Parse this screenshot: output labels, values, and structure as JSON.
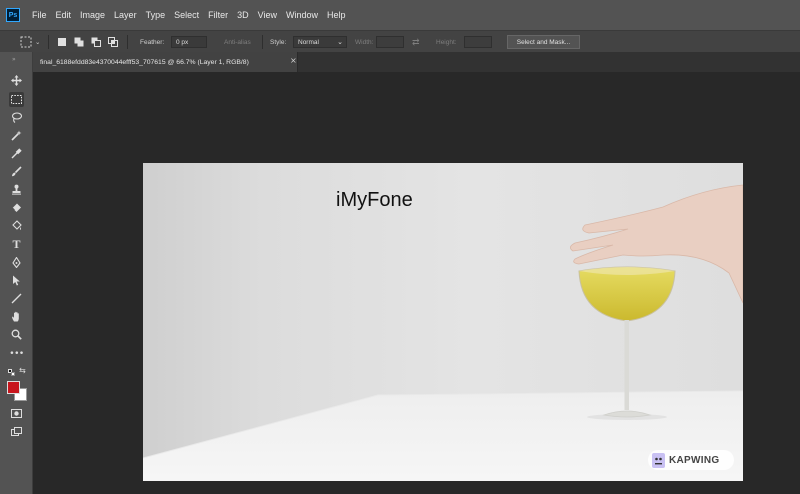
{
  "app": {
    "icon_text": "Ps"
  },
  "menu": [
    "File",
    "Edit",
    "Image",
    "Layer",
    "Type",
    "Select",
    "Filter",
    "3D",
    "View",
    "Window",
    "Help"
  ],
  "options": {
    "feather_label": "Feather:",
    "feather_value": "0 px",
    "antialias_label": "Anti-alias",
    "style_label": "Style:",
    "style_value": "Normal",
    "width_label": "Width:",
    "height_label": "Height:",
    "select_mask_button": "Select and Mask..."
  },
  "document_tab": {
    "title": "final_6188efdd83e4370044efff53_707615 @ 66.7% (Layer 1, RGB/8)",
    "close": "×"
  },
  "tools": [
    "move-tool",
    "rectangular-marquee-tool",
    "lasso-tool",
    "quick-selection-tool",
    "eyedropper-tool",
    "brush-tool",
    "clone-stamp-tool",
    "eraser-tool",
    "paint-bucket-tool",
    "type-tool",
    "pen-tool",
    "path-selection-tool",
    "line-tool",
    "hand-tool",
    "zoom-tool",
    "more-tools"
  ],
  "colors": {
    "foreground": "#c8161d",
    "background": "#ffffff",
    "accent": "#31a8ff"
  },
  "canvas": {
    "text_layer": "iMyFone",
    "watermark": "KAPWING"
  }
}
